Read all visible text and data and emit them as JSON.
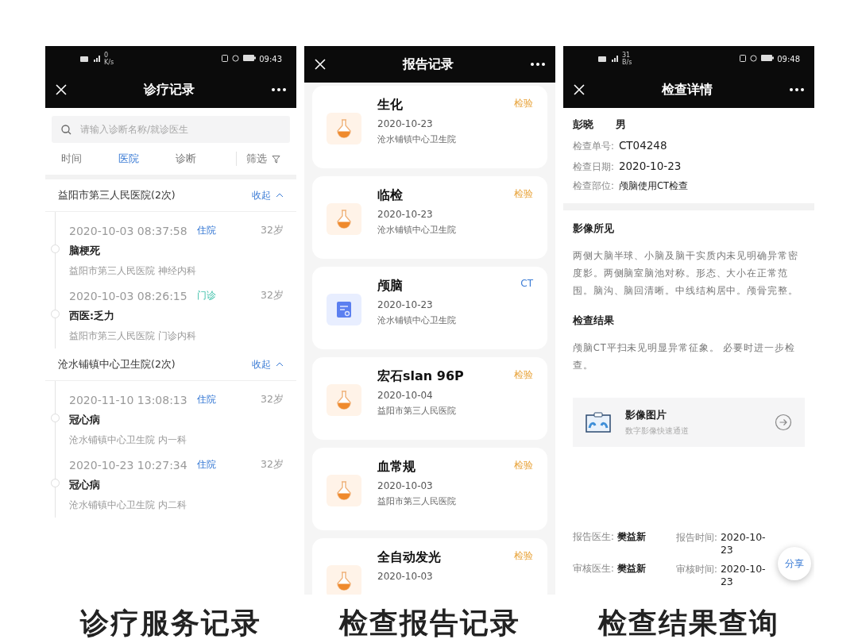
{
  "panels": [
    {
      "kind": "records",
      "caption": "诊疗服务记录",
      "status_bar": {
        "speed": "0",
        "speed_unit": "K/s",
        "time": "09:43"
      },
      "title": "诊疗记录",
      "search": {
        "placeholder": "请输入诊断名称/就诊医生"
      },
      "tabs": [
        {
          "label": "时间",
          "selected": false
        },
        {
          "label": "医院",
          "selected": true
        },
        {
          "label": "诊断",
          "selected": false
        }
      ],
      "filter": "筛选",
      "groups": [
        {
          "name": "益阳市第三人民医院(2次)",
          "toggle": "收起",
          "expanded": true,
          "visits": [
            {
              "time": "2020-10-03 08:37:58",
              "type": "住院",
              "kind": "inpatient",
              "age": "32岁",
              "diagnosis": "脑梗死",
              "place": "益阳市第三人民医院 神经内科"
            },
            {
              "time": "2020-10-03 08:26:15",
              "type": "门诊",
              "kind": "outpatient",
              "age": "32岁",
              "diagnosis": "西医:乏力",
              "place": "益阳市第三人民医院 门诊内科"
            }
          ]
        },
        {
          "name": "沧水铺镇中心卫生院(2次)",
          "toggle": "收起",
          "expanded": true,
          "visits": [
            {
              "time": "2020-11-10 13:08:13",
              "type": "住院",
              "kind": "inpatient",
              "age": "32岁",
              "diagnosis": "冠心病",
              "place": "沧水铺镇中心卫生院 内一科"
            },
            {
              "time": "2020-10-23 10:27:34",
              "type": "住院",
              "kind": "inpatient",
              "age": "32岁",
              "diagnosis": "冠心病",
              "place": "沧水铺镇中心卫生院 内二科"
            }
          ]
        }
      ]
    },
    {
      "kind": "reports",
      "caption": "检查报告记录",
      "title": "报告记录",
      "cards": [
        {
          "kind": "lab",
          "name": "生化",
          "date": "2020-10-23",
          "hospital": "沧水铺镇中心卫生院",
          "tag": "检验"
        },
        {
          "kind": "lab",
          "name": "临检",
          "date": "2020-10-23",
          "hospital": "沧水铺镇中心卫生院",
          "tag": "检验"
        },
        {
          "kind": "imaging",
          "name": "颅脑",
          "date": "2020-10-23",
          "hospital": "沧水铺镇中心卫生院",
          "tag": "CT"
        },
        {
          "kind": "lab",
          "name": "宏石slan  96P",
          "date": "2020-10-04",
          "hospital": "益阳市第三人民医院",
          "tag": "检验"
        },
        {
          "kind": "lab",
          "name": "血常规",
          "date": "2020-10-03",
          "hospital": "益阳市第三人民医院",
          "tag": "检验"
        },
        {
          "kind": "lab",
          "name": "全自动发光",
          "date": "2020-10-03",
          "tag": "检验"
        }
      ]
    },
    {
      "kind": "detail",
      "caption": "检查结果查询",
      "status_bar": {
        "speed": "31",
        "speed_unit": "B/s",
        "time": "09:48"
      },
      "title": "检查详情",
      "patient": {
        "name": "彭晓",
        "gender": "男"
      },
      "fields": [
        {
          "label": "检查单号:",
          "value": "CT04248"
        },
        {
          "label": "检查日期:",
          "value": "2020-10-23"
        },
        {
          "label": "检查部位:",
          "value": "颅脑使用CT检查"
        }
      ],
      "sections": [
        {
          "heading": "影像所见",
          "text": "两侧大脑半球、小脑及脑干实质内未见明确异常密度影。两侧脑室脑池对称。形态、大小在正常范围。脑沟、脑回清晰。中线结构居中。颅骨完整。"
        },
        {
          "heading": "检查结果",
          "text": "颅脑CT平扫未见明显异常征象。 必要时进一步检查。"
        }
      ],
      "image_link": {
        "title": "影像图片",
        "subtitle": "数字影像快速通道"
      },
      "signoff": [
        {
          "label": "报告医生:",
          "name": "樊益新",
          "time_label": "报告时间:",
          "time": "2020-10-23"
        },
        {
          "label": "审核医生:",
          "name": "樊益新",
          "time_label": "审核时间:",
          "time": "2020-10-23"
        }
      ],
      "share": "分享"
    }
  ]
}
